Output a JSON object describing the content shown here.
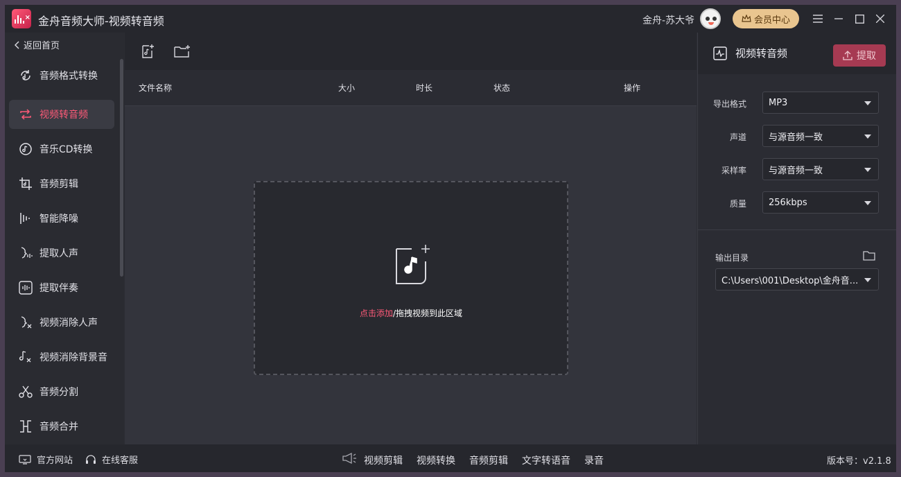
{
  "app": {
    "title": "金舟音频大师-视频转音频",
    "user_name": "金舟-苏大爷",
    "vip_label": "会员中心"
  },
  "sidebar": {
    "back_label": "返回首页",
    "items": [
      {
        "label": "音频格式转换",
        "icon": "audio-convert-icon"
      },
      {
        "label": "视频转音频",
        "icon": "video-to-audio-icon",
        "active": true
      },
      {
        "label": "音乐CD转换",
        "icon": "cd-icon"
      },
      {
        "label": "音频剪辑",
        "icon": "audio-edit-icon"
      },
      {
        "label": "智能降噪",
        "icon": "denoise-icon"
      },
      {
        "label": "提取人声",
        "icon": "vocal-icon"
      },
      {
        "label": "提取伴奏",
        "icon": "accompaniment-icon"
      },
      {
        "label": "视频消除人声",
        "icon": "remove-vocal-icon"
      },
      {
        "label": "视频消除背景音",
        "icon": "remove-bg-icon"
      },
      {
        "label": "音频分割",
        "icon": "scissors-icon"
      },
      {
        "label": "音频合并",
        "icon": "merge-icon"
      }
    ]
  },
  "table": {
    "headers": [
      "文件名称",
      "大小",
      "时长",
      "状态",
      "操作"
    ]
  },
  "dropzone": {
    "link_text": "点击添加",
    "text": "/拖拽视频到此区域"
  },
  "right_panel": {
    "title": "视频转音频",
    "extract_label": "提取",
    "fields": [
      {
        "label": "导出格式",
        "value": "MP3"
      },
      {
        "label": "声道",
        "value": "与源音频一致"
      },
      {
        "label": "采样率",
        "value": "与源音频一致"
      },
      {
        "label": "质量",
        "value": "256kbps"
      }
    ],
    "output_label": "输出目录",
    "output_path": "C:\\Users\\001\\Desktop\\金舟音..."
  },
  "bottom": {
    "website": "官方网站",
    "service": "在线客服",
    "links": [
      "视频剪辑",
      "视频转换",
      "音频剪辑",
      "文字转语音",
      "录音"
    ],
    "version": "版本号：v2.1.8"
  },
  "colors": {
    "accent": "#ff5a78",
    "vip": "#e9c58f",
    "extract_btn": "#a63a52"
  }
}
